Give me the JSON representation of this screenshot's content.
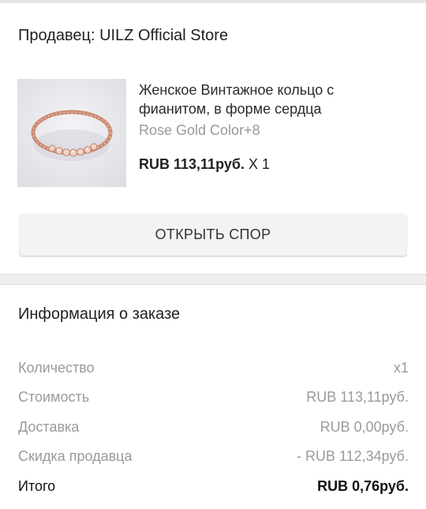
{
  "seller": {
    "label": "Продавец: UILZ Official Store"
  },
  "product": {
    "title": "Женское Винтажное кольцо с фианитом, в форме сердца",
    "variant": "Rose Gold Color+8",
    "price": "RUB 113,11руб.",
    "quantity": "X 1",
    "image_icon": "rose-gold-ring-photo"
  },
  "dispute": {
    "button_label": "ОТКРЫТЬ СПОР"
  },
  "order_info": {
    "heading": "Информация о заказе",
    "rows": [
      {
        "label": "Количество",
        "value": "x1"
      },
      {
        "label": "Стоимость",
        "value": "RUB 113,11руб."
      },
      {
        "label": "Доставка",
        "value": "RUB 0,00руб."
      },
      {
        "label": "Скидка продавца",
        "value": "- RUB 112,34руб."
      },
      {
        "label": "Итого",
        "value": "RUB 0,76руб."
      }
    ]
  },
  "colors": {
    "background": "#eeeeee",
    "card": "#ffffff",
    "muted_text": "#9a9a9a",
    "primary_text": "#212121",
    "button_bg": "#f3f3f3",
    "ring_rose_gold": "#d9a08a"
  }
}
